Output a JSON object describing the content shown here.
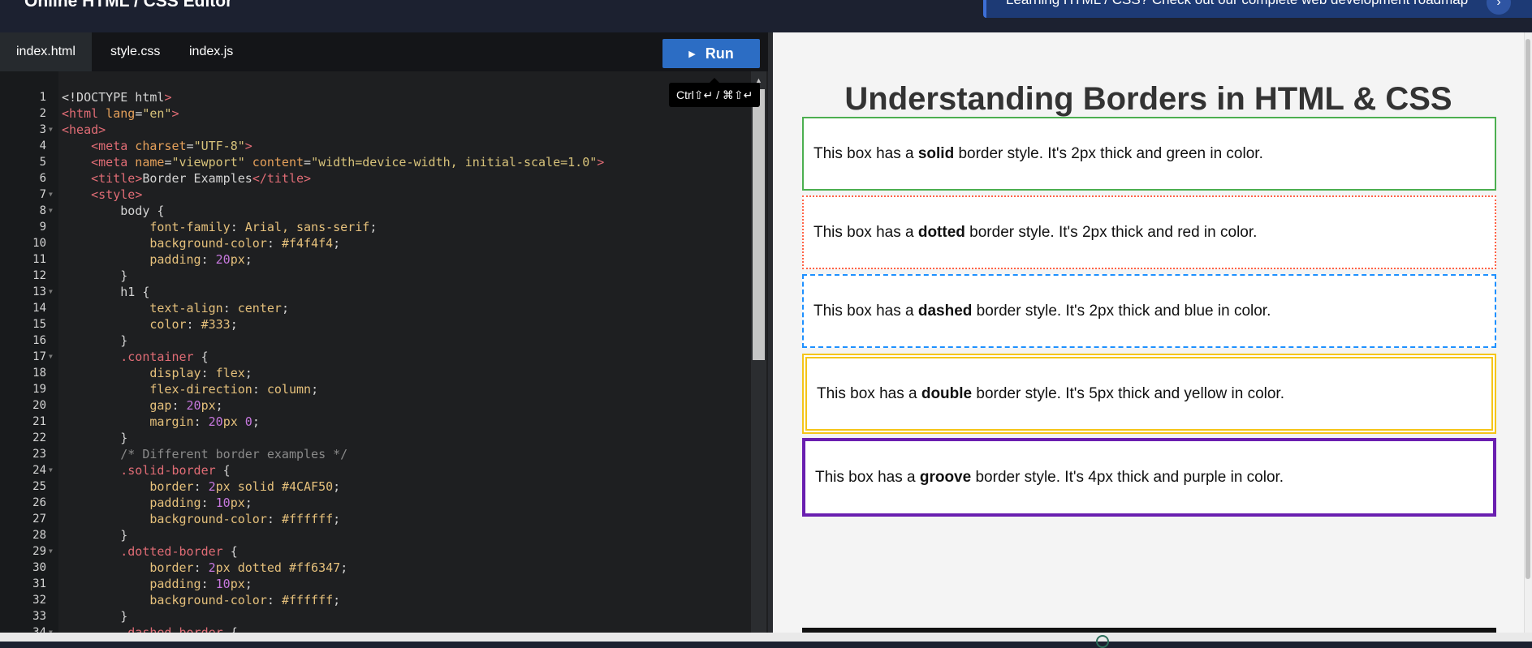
{
  "header": {
    "title": "Online HTML / CSS Editor",
    "banner_text": "Learning HTML / CSS? Check out our complete web development roadmap",
    "banner_arrow": "›"
  },
  "editor": {
    "tabs": [
      {
        "label": "index.html"
      },
      {
        "label": "style.css"
      },
      {
        "label": "index.js"
      }
    ],
    "run_label": "Run",
    "run_tooltip": "Ctrl⇧↵ / ⌘⇧↵",
    "lines": [
      "<!DOCTYPE html>",
      "<html lang=\"en\">",
      "<head>",
      "    <meta charset=\"UTF-8\">",
      "    <meta name=\"viewport\" content=\"width=device-width, initial-scale=1.0\">",
      "    <title>Border Examples</title>",
      "    <style>",
      "        body {",
      "            font-family: Arial, sans-serif;",
      "            background-color: #f4f4f4;",
      "            padding: 20px;",
      "        }",
      "        h1 {",
      "            text-align: center;",
      "            color: #333;",
      "        }",
      "        .container {",
      "            display: flex;",
      "            flex-direction: column;",
      "            gap: 20px;",
      "            margin: 20px 0;",
      "        }",
      "        /* Different border examples */",
      "        .solid-border {",
      "            border: 2px solid #4CAF50;",
      "            padding: 10px;",
      "            background-color: #ffffff;",
      "        }",
      "        .dotted-border {",
      "            border: 2px dotted #ff6347;",
      "            padding: 10px;",
      "            background-color: #ffffff;",
      "        }",
      "        .dashed-border {"
    ],
    "fold_lines": [
      3,
      7,
      8,
      13,
      17,
      24,
      29,
      34
    ]
  },
  "preview": {
    "title": "Understanding Borders in HTML & CSS",
    "boxes": [
      {
        "pre": "This box has a ",
        "style": "solid",
        "post": " border style. It's 2px thick and green in color.",
        "border": "2px solid #4CAF50"
      },
      {
        "pre": "This box has a ",
        "style": "dotted",
        "post": " border style. It's 2px thick and red in color.",
        "border": "2px dotted #ff6347"
      },
      {
        "pre": "This box has a ",
        "style": "dashed",
        "post": " border style. It's 2px thick and blue in color.",
        "border": "2px dashed #1e90ff"
      },
      {
        "pre": "This box has a ",
        "style": "double",
        "post": " border style. It's 5px thick and yellow in color.",
        "border": "6px double #f5c518"
      },
      {
        "pre": "This box has a ",
        "style": "groove",
        "post": " border style. It's 4px thick and purple in color.",
        "border": "4px solid #6a1fb0"
      }
    ]
  },
  "colors": {
    "tag": "#e06c75",
    "attr": "#e5a05a",
    "string": "#d7c27a",
    "prop": "#e5c07b",
    "number": "#c678dd",
    "selector": "#e06c75",
    "comment": "#8a8a8a",
    "plain": "#d4d4d4"
  }
}
